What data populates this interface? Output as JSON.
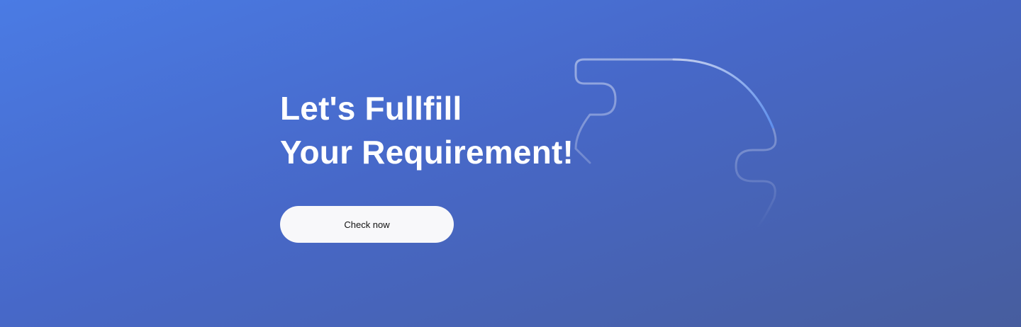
{
  "banner": {
    "headline_line1": "Let's Fullfill",
    "headline_line2": "Your Requirement!",
    "cta_label": "Check now"
  },
  "colors": {
    "gradient_start": "#4a7be4",
    "gradient_mid": "#4768c8",
    "gradient_end": "#475d9e",
    "headline": "#ffffff",
    "button_background": "#f8f8fa",
    "button_text": "#111111"
  }
}
